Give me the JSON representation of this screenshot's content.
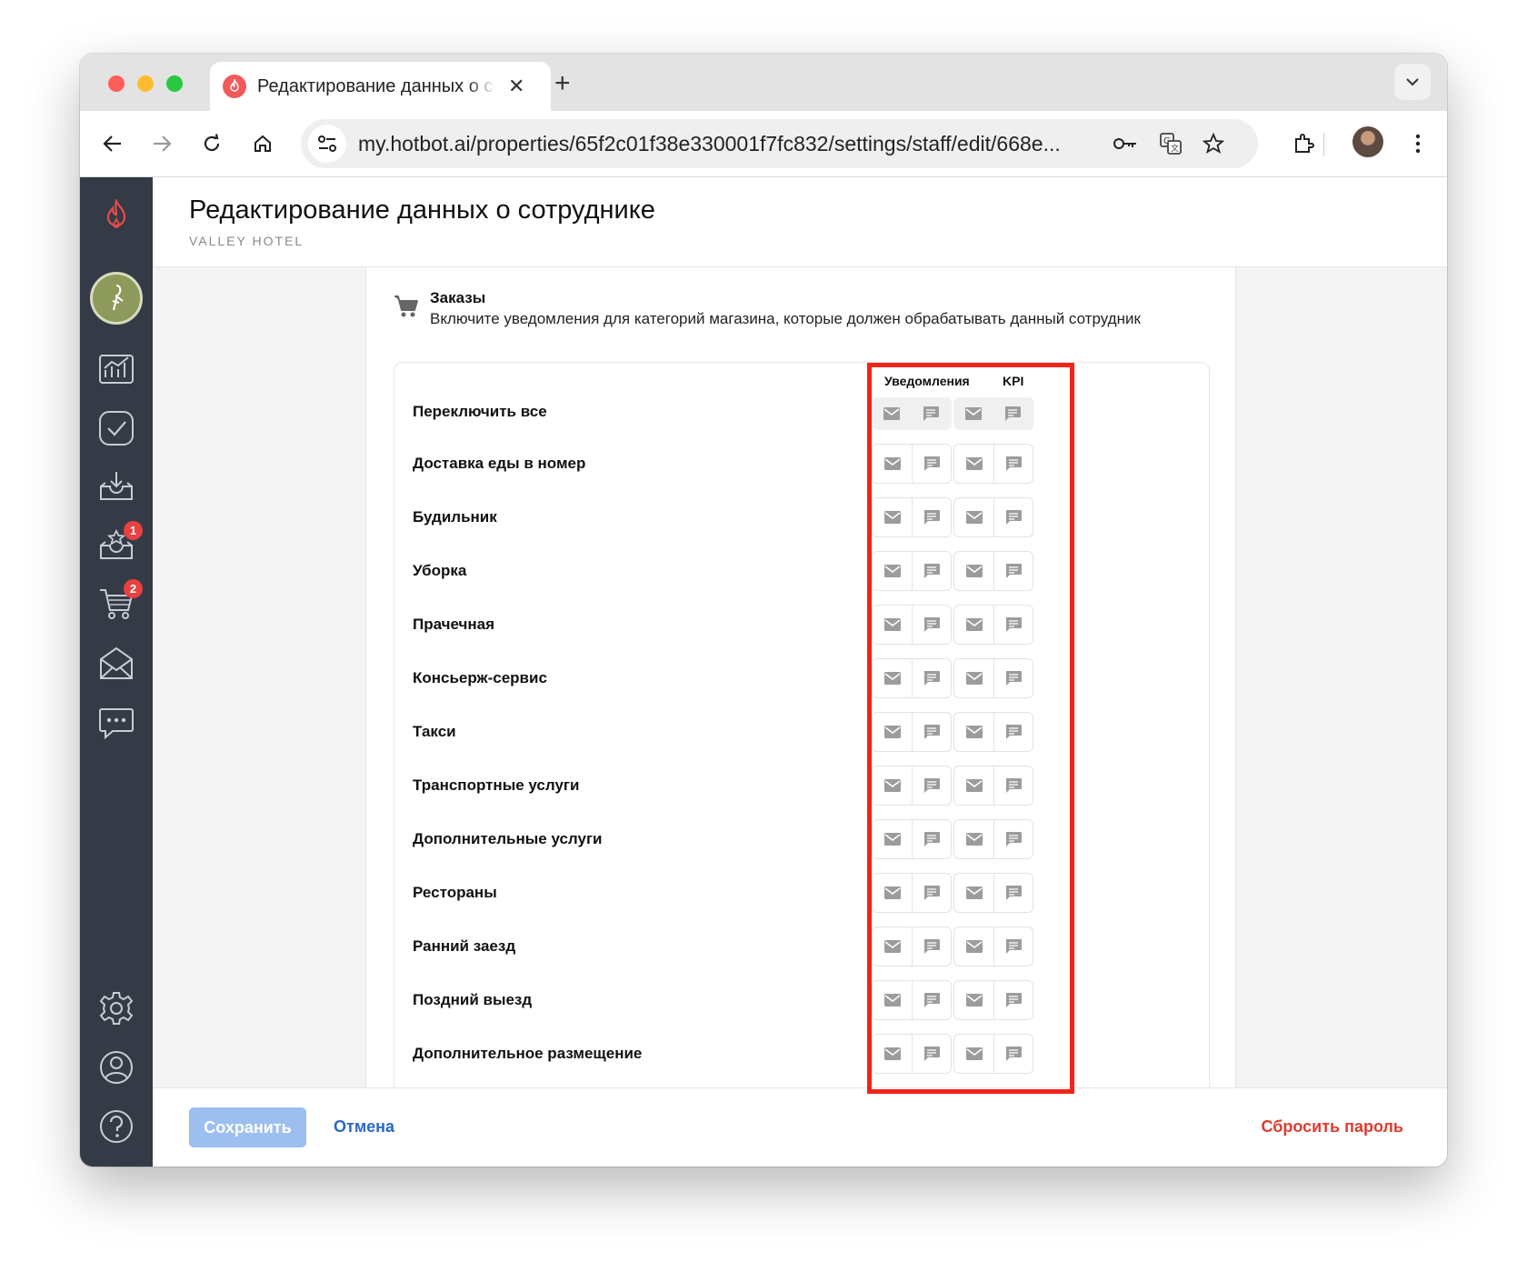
{
  "browser": {
    "tab_title": "Редактирование данных о сотруднике",
    "url": "my.hotbot.ai/properties/65f2c01f38e330001f7fc832/settings/staff/edit/668e..."
  },
  "sidebar": {
    "badges": {
      "tasks": "1",
      "orders": "2"
    }
  },
  "header": {
    "title": "Редактирование данных о сотруднике",
    "subtitle": "VALLEY HOTEL"
  },
  "section": {
    "title": "Заказы",
    "description": "Включите уведомления для категорий магазина, которые должен обрабатывать данный сотрудник"
  },
  "table": {
    "columns": {
      "notifications": "Уведомления",
      "kpi": "KPI"
    },
    "toggle_all_label": "Переключить все",
    "rows": [
      {
        "label": "Доставка еды в номер"
      },
      {
        "label": "Будильник"
      },
      {
        "label": "Уборка"
      },
      {
        "label": "Прачечная"
      },
      {
        "label": "Консьерж-сервис"
      },
      {
        "label": "Такси"
      },
      {
        "label": "Транспортные услуги"
      },
      {
        "label": "Дополнительные услуги"
      },
      {
        "label": "Рестораны"
      },
      {
        "label": "Ранний заезд"
      },
      {
        "label": "Поздний выезд"
      },
      {
        "label": "Дополнительное размещение"
      }
    ]
  },
  "footer": {
    "save": "Сохранить",
    "cancel": "Отмена",
    "reset_password": "Сбросить пароль"
  },
  "colors": {
    "sidebar": "#343a46",
    "accent": "#2a67c9",
    "danger": "#e03b2e",
    "highlight": "#f0241a",
    "save_disabled": "#9dbff0"
  },
  "icons": [
    "mail-icon",
    "chat-icon",
    "cart-icon",
    "flame-icon",
    "chart-icon",
    "check-icon",
    "inbox-icon",
    "star-inbox-icon",
    "open-mail-icon",
    "message-icon",
    "gear-icon",
    "user-icon",
    "help-icon"
  ]
}
